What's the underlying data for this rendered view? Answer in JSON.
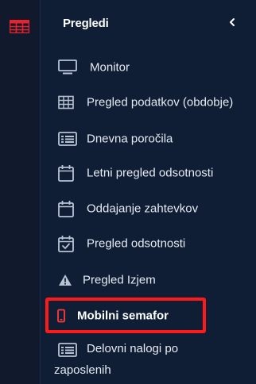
{
  "sidebar_rail": {
    "icon": "table-grid-icon",
    "accent": "#e8232b"
  },
  "panel": {
    "title": "Pregledi",
    "collapse_icon": "chevron-left-icon"
  },
  "menu": {
    "items": [
      {
        "label": "Monitor",
        "icon": "monitor-icon"
      },
      {
        "label": "Pregled podatkov (obdobje)",
        "icon": "table-icon"
      },
      {
        "label": "Dnevna poročila",
        "icon": "list-icon"
      },
      {
        "label": "Letni pregled odsotnosti",
        "icon": "calendar-icon"
      },
      {
        "label": "Oddajanje zahtevkov",
        "icon": "calendar-icon"
      },
      {
        "label": "Pregled odsotnosti",
        "icon": "calendar-check-icon"
      },
      {
        "label": "Pregled Izjem",
        "icon": "warning-icon"
      },
      {
        "label": "Mobilni semafor",
        "icon": "mobile-icon",
        "active": true
      },
      {
        "label_line1": "Delovni nalogi po",
        "label_line2": "zaposlenih",
        "icon": "list-icon"
      }
    ]
  },
  "colors": {
    "background": "#0f1d35",
    "highlight_border": "#ff1a1a",
    "mobile_icon": "#ff3b3b"
  }
}
